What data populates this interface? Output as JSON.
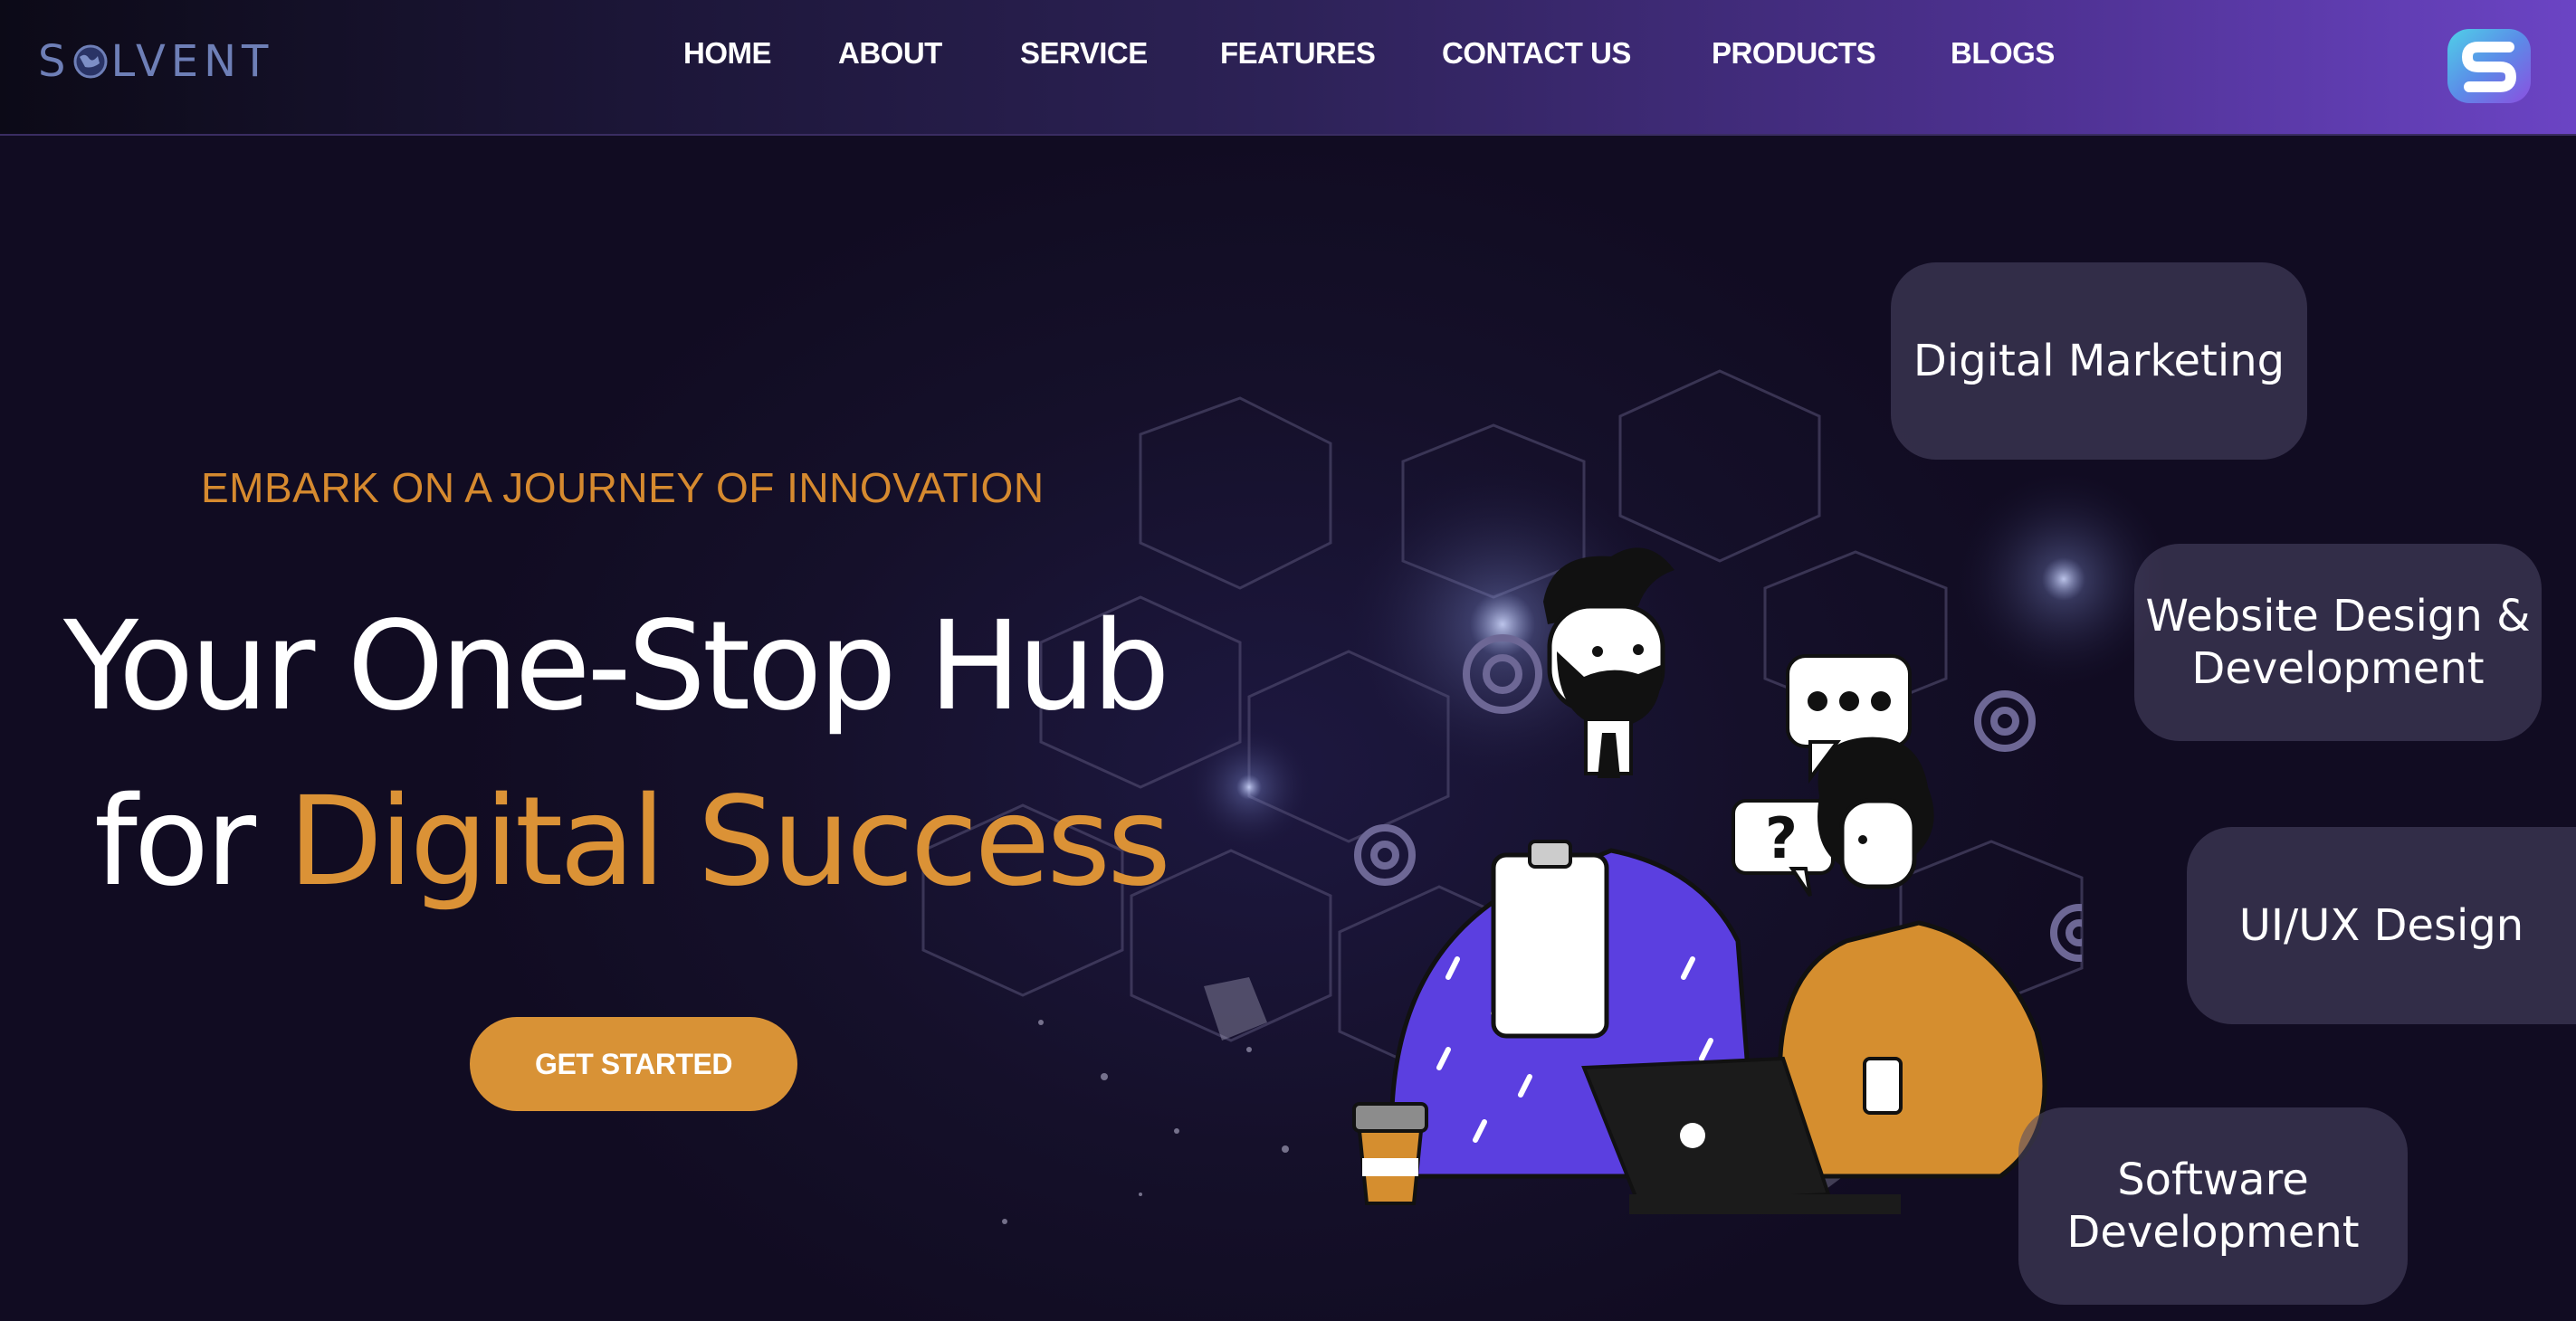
{
  "brand": {
    "logo_text_before": "S",
    "logo_text_after": "LVENT"
  },
  "nav": {
    "items": [
      {
        "label": "HOME"
      },
      {
        "label": "ABOUT"
      },
      {
        "label": "SERVICE"
      },
      {
        "label": "FEATURES"
      },
      {
        "label": "CONTACT US"
      },
      {
        "label": "PRODUCTS"
      },
      {
        "label": "BLOGS"
      }
    ]
  },
  "hero": {
    "tagline": "EMBARK ON A JOURNEY OF INNOVATION",
    "headline_line1": "Your One-Stop Hub",
    "headline_line2_prefix": "for ",
    "headline_line2_accent": "Digital Success",
    "cta_label": "GET STARTED"
  },
  "services": {
    "cards": [
      {
        "label_line1": "Digital Marketing",
        "label_line2": ""
      },
      {
        "label_line1": "Website Design &",
        "label_line2": "Development"
      },
      {
        "label_line1": "UI/UX Design",
        "label_line2": ""
      },
      {
        "label_line1": "Software",
        "label_line2": "Development"
      }
    ]
  },
  "colors": {
    "accent": "#d89236",
    "nav_gradient_end": "#6b44c4",
    "background": "#171129"
  },
  "icons": [
    "globe-icon",
    "brand-s-icon",
    "gear-icon",
    "chat-bubble-icon",
    "question-bubble-icon",
    "coffee-cup-icon",
    "laptop-icon"
  ]
}
